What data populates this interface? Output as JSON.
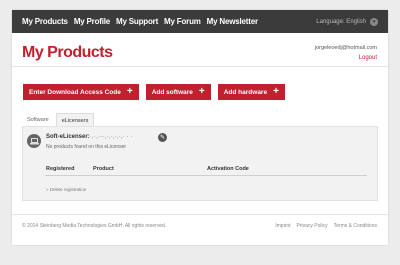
{
  "nav": {
    "links": [
      "My Products",
      "My Profile",
      "My Support",
      "My Forum",
      "My Newsletter"
    ],
    "language": "Language: English"
  },
  "header": {
    "title": "My Products",
    "email": "jorgeleoedj@hotmail.com",
    "logout": "Logout"
  },
  "buttons": {
    "download_code": "Enter Download Access Code",
    "add_software": "Add software",
    "add_hardware": "Add hardware"
  },
  "tabs": [
    "Software",
    "eLicensers"
  ],
  "panel": {
    "license_title": "Soft-eLicenser:",
    "license_serial": "·,·,·-·,·,·,·,·,·  ·  ·",
    "no_products": "No products found on this eLicenser",
    "columns": {
      "registered": "Registered",
      "product": "Product",
      "activation": "Activation Code"
    },
    "delete": "Delete registration"
  },
  "footer": {
    "copyright": "© 2014 Steinberg Media Technologies GmbH. All rights reserved.",
    "links": [
      "Imprint",
      "Privacy Policy",
      "Terms & Conditions"
    ]
  },
  "colors": {
    "accent": "#c1202f",
    "nav_bg": "#3b3b3b",
    "page_bg": "#ececec"
  }
}
